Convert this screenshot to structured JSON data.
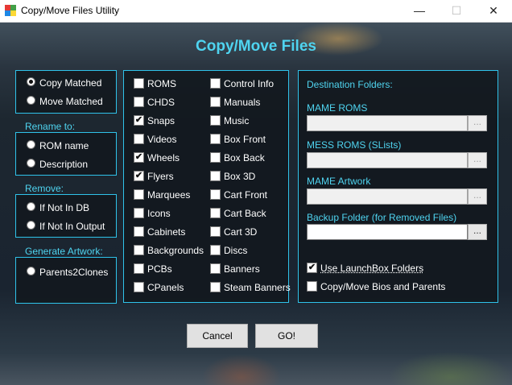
{
  "window": {
    "title": "Copy/Move Files Utility",
    "minimize_glyph": "—",
    "maximize_glyph": "☐",
    "close_glyph": "✕",
    "app_icon_colors": [
      "#e53935",
      "#43a047",
      "#1e88e5",
      "#fdd835"
    ]
  },
  "header": {
    "title": "Copy/Move Files"
  },
  "mode": {
    "options": [
      {
        "label": "Copy Matched",
        "selected": true
      },
      {
        "label": "Move Matched",
        "selected": false
      }
    ]
  },
  "rename": {
    "title": "Rename to:",
    "options": [
      {
        "label": "ROM name",
        "selected": false
      },
      {
        "label": "Description",
        "selected": false
      }
    ]
  },
  "remove": {
    "title": "Remove:",
    "options": [
      {
        "label": "If Not In DB",
        "selected": false
      },
      {
        "label": "If Not In Output",
        "selected": false
      }
    ]
  },
  "artwork": {
    "title": "Generate Artwork:",
    "options": [
      {
        "label": "Parents2Clones",
        "selected": false
      }
    ]
  },
  "file_types": {
    "col1": [
      {
        "label": "ROMS",
        "checked": false
      },
      {
        "label": "CHDS",
        "checked": false
      },
      {
        "label": "Snaps",
        "checked": true
      },
      {
        "label": "Videos",
        "checked": false
      },
      {
        "label": "Wheels",
        "checked": true
      },
      {
        "label": "Flyers",
        "checked": true
      },
      {
        "label": "Marquees",
        "checked": false
      },
      {
        "label": "Icons",
        "checked": false
      },
      {
        "label": "Cabinets",
        "checked": false
      },
      {
        "label": "Backgrounds",
        "checked": false
      },
      {
        "label": "PCBs",
        "checked": false
      },
      {
        "label": "CPanels",
        "checked": false
      }
    ],
    "col2": [
      {
        "label": "Control Info",
        "checked": false
      },
      {
        "label": "Manuals",
        "checked": false
      },
      {
        "label": "Music",
        "checked": false
      },
      {
        "label": "Box Front",
        "checked": false
      },
      {
        "label": "Box Back",
        "checked": false
      },
      {
        "label": "Box 3D",
        "checked": false
      },
      {
        "label": "Cart Front",
        "checked": false
      },
      {
        "label": "Cart Back",
        "checked": false
      },
      {
        "label": "Cart 3D",
        "checked": false
      },
      {
        "label": "Discs",
        "checked": false
      },
      {
        "label": "Banners",
        "checked": false
      },
      {
        "label": "Steam Banners",
        "checked": false
      }
    ]
  },
  "destination": {
    "title": "Destination Folders:",
    "folders": [
      {
        "label": "MAME ROMS",
        "value": "",
        "enabled": false,
        "browse": "..."
      },
      {
        "label": "MESS ROMS (SLists)",
        "value": "",
        "enabled": false,
        "browse": "..."
      },
      {
        "label": "MAME Artwork",
        "value": "",
        "enabled": false,
        "browse": "..."
      },
      {
        "label": "Backup Folder (for Removed Files)",
        "value": "",
        "enabled": true,
        "browse": "..."
      }
    ],
    "use_launchbox": {
      "label": "Use LaunchBox Folders",
      "checked": true
    },
    "copy_bios": {
      "label": "Copy/Move Bios and Parents",
      "checked": false
    }
  },
  "buttons": {
    "cancel": "Cancel",
    "go": "GO!"
  },
  "check_glyph": "✔",
  "colors": {
    "accent": "#4fd4f0",
    "panel_border": "#2fc3ea"
  }
}
